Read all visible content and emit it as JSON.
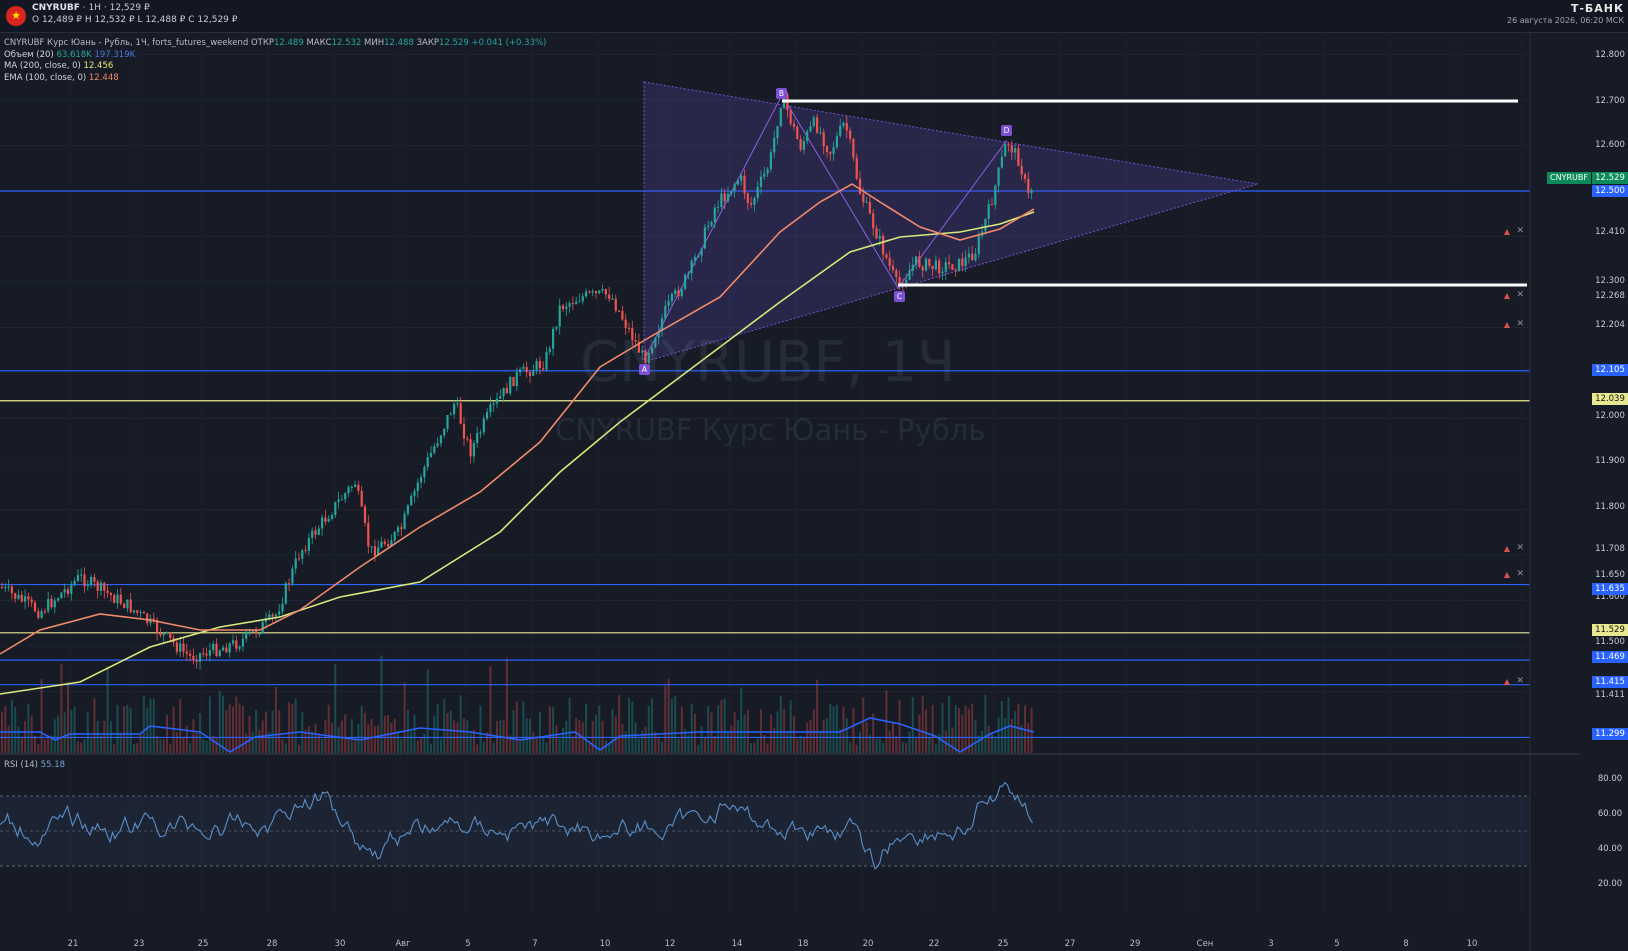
{
  "header": {
    "flag_icon": "china-flag-icon",
    "symbol": "CNYRUBF",
    "interval": "1Н",
    "price": "12,529 ₽",
    "ohlc": "O 12,489 ₽  H 12,532 ₽  L 12,488 ₽  C 12,529 ₽",
    "brand": "Т-БАНК",
    "datetime": "26 августа 2026, 06:20 МСК"
  },
  "legend": {
    "main_title": "CNYRUBF Курс Юань - Рубль, 1Ч, forts_futures_weekend",
    "open_label": "ОТКР",
    "open": "12.489",
    "high_label": "МАКС",
    "high": "12.532",
    "low_label": "МИН",
    "low": "12.488",
    "close_label": "ЗАКР",
    "close": "12.529",
    "change": "+0.041 (+0.33%)",
    "volume_label": "Объем (20)",
    "volume_1": "63.618K",
    "volume_2": "197.319K",
    "ma_label": "MA (200, close, 0)",
    "ma_value": "12.456",
    "ema_label": "EMA (100, close, 0)",
    "ema_value": "12.448",
    "rsi_label": "RSI (14)",
    "rsi_value": "55.18"
  },
  "watermark": {
    "line1": "CNYRUBF, 1Ч",
    "line2": "CNYRUBF Курс Юань - Рубль"
  },
  "price_axis": {
    "ticks": [
      "12.800",
      "12.700",
      "12.600",
      "12.500",
      "12.300",
      "12.000",
      "11.900",
      "11.800",
      "11.600",
      "11.500",
      "11.411"
    ],
    "tagged_levels": [
      {
        "value": "12.529",
        "style": "green"
      },
      {
        "value": "12.500",
        "style": "blue"
      },
      {
        "value": "12.410",
        "style": "plain"
      },
      {
        "value": "12.268",
        "style": "plain"
      },
      {
        "value": "12.204",
        "style": "plain"
      },
      {
        "value": "12.105",
        "style": "blue"
      },
      {
        "value": "12.039",
        "style": "yellow"
      },
      {
        "value": "11.708",
        "style": "plain"
      },
      {
        "value": "11.650",
        "style": "plain"
      },
      {
        "value": "11.635",
        "style": "blue"
      },
      {
        "value": "11.529",
        "style": "yellow"
      },
      {
        "value": "11.469",
        "style": "blue"
      },
      {
        "value": "11.415",
        "style": "blue"
      },
      {
        "value": "11.299",
        "style": "blue"
      }
    ],
    "symbol_tag": "CNYRUBF"
  },
  "rsi_axis": {
    "ticks": [
      "80.00",
      "60.00",
      "40.00",
      "20.00"
    ]
  },
  "time_axis": {
    "labels": [
      "21",
      "23",
      "25",
      "28",
      "30",
      "Авг",
      "5",
      "7",
      "10",
      "12",
      "14",
      "18",
      "20",
      "22",
      "25",
      "27",
      "29",
      "Сен",
      "3",
      "5",
      "8",
      "10"
    ]
  },
  "pattern_points": [
    "A",
    "B",
    "C",
    "D"
  ],
  "colors": {
    "background": "#161b26",
    "hline_blue": "#2962ff",
    "hline_yellow": "#e8e890",
    "ma": "#d9e87a",
    "ema": "#f08a6a",
    "pattern": "#7b4fd6",
    "up": "#26a69a",
    "down": "#ef5350",
    "rsi": "#5b8ec9"
  },
  "alert_icons": [
    "bell-icon",
    "close-icon"
  ]
}
